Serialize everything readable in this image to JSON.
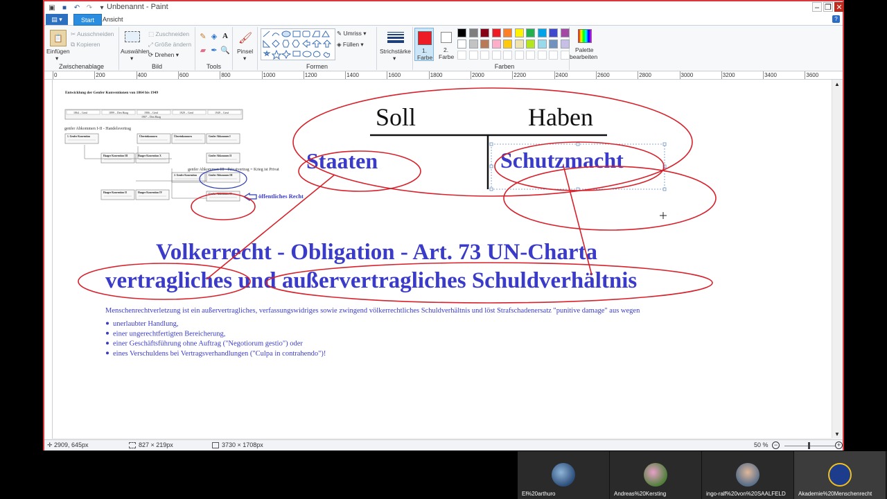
{
  "window": {
    "title": "Unbenannt - Paint",
    "controls": {
      "minimize": "–",
      "restore": "❐",
      "close": "✕"
    }
  },
  "tabs": [
    {
      "label": "Start",
      "active": true
    },
    {
      "label": "Ansicht",
      "active": false
    }
  ],
  "ribbon": {
    "clipboard": {
      "label": "Zwischenablage",
      "paste": "Einfügen",
      "cut": "Ausschneiden",
      "copy": "Kopieren"
    },
    "image": {
      "label": "Bild",
      "select": "Auswählen",
      "crop": "Zuschneiden",
      "resize": "Größe ändern",
      "rotate": "Drehen"
    },
    "tools": {
      "label": "Tools"
    },
    "brush": {
      "label": "Pinsel"
    },
    "shapes": {
      "label": "Formen",
      "outline": "Umriss",
      "fill": "Füllen"
    },
    "stroke": {
      "label": "Strichstärke"
    },
    "color1": {
      "label1": "1.",
      "label2": "Farbe",
      "value": "#ed1c24"
    },
    "color2": {
      "label1": "2.",
      "label2": "Farbe",
      "value": "#ffffff"
    },
    "colors": {
      "label": "Farben"
    },
    "edit_palette": {
      "label1": "Palette",
      "label2": "bearbeiten"
    },
    "palette": [
      "#000000",
      "#7f7f7f",
      "#880015",
      "#ed1c24",
      "#ff7f27",
      "#fff200",
      "#22b14c",
      "#00a2e8",
      "#3f48cc",
      "#a349a4",
      "#ffffff",
      "#c3c3c3",
      "#b97a57",
      "#ffaec9",
      "#ffc90e",
      "#efe4b0",
      "#b5e61d",
      "#99d9ea",
      "#7092be",
      "#c8bfe7"
    ]
  },
  "ruler": [
    "0",
    "200",
    "400",
    "600",
    "800",
    "1000",
    "1200",
    "1400",
    "1600",
    "1800",
    "2000",
    "2200",
    "2400",
    "2600",
    "2800",
    "3000",
    "3200",
    "3400",
    "3600"
  ],
  "canvas": {
    "thumb_title": "Entwicklung der Genfer Konventionen von 1864 bis 1949",
    "thumb_timeline": [
      "1864 – Genf",
      "1899 – Den Haag",
      "1906 – Genf",
      "1929 – Genf",
      "1949 – Genf"
    ],
    "thumb_timeline_sub": "1907 – Den Haag",
    "thumb_note1": "genfer Abkommen I-II  -  Handelsvertrag",
    "thumb_note2": "genfer Abkommen III - Privatvertrag = Krieg ist Privat",
    "thumb_boxes": [
      "1. Genfer Konvention",
      "Übereinkommen",
      "Übereinkommen",
      "Genfer Abkommen I",
      "Haager Konvention III",
      "Haager Konvention X",
      "Genfer Abkommen II",
      "2. Genfer Konvention",
      "Genfer Abkommen III",
      "Haager Konvention II",
      "Haager Konvention IV",
      "Genfer Abkommen IV"
    ],
    "oeffentliches": "öffentliches Recht",
    "soll": "Soll",
    "haben": "Haben",
    "staaten": "Staaten",
    "schutzmacht": "Schutzmacht",
    "heading1": "Volkerrecht - Obligation - Art. 73 UN-Charta",
    "heading2": "vertragliches und außervertragliches Schuldverhältnis",
    "paragraph": "Menschenrechtverletzung ist ein außervertragliches, verfassungswidriges sowie zwingend völkerrechtliches Schuldverhältnis und löst Strafschadenersatz \"punitive damage\" aus wegen",
    "bullets": [
      "unerlaubter Handlung,",
      "einer ungerechtfertigten Bereicherung,",
      "einer Geschäftsführung ohne Auftrag (\"Negotiorum gestio\") oder",
      "eines Verschuldens bei Vertragsverhandlungen (\"Culpa in contrahendo\")!"
    ]
  },
  "status": {
    "cursor": "2909, 645px",
    "selection": "827 × 219px",
    "size": "3730 × 1708px",
    "zoom": "50 %"
  },
  "participants": [
    {
      "name": "El%20arthuro"
    },
    {
      "name": "Andreas%20Kersting"
    },
    {
      "name": "ingo-ralf%20von%20SAALFELD"
    },
    {
      "name": "Akademie%20Menschenrecht"
    }
  ]
}
